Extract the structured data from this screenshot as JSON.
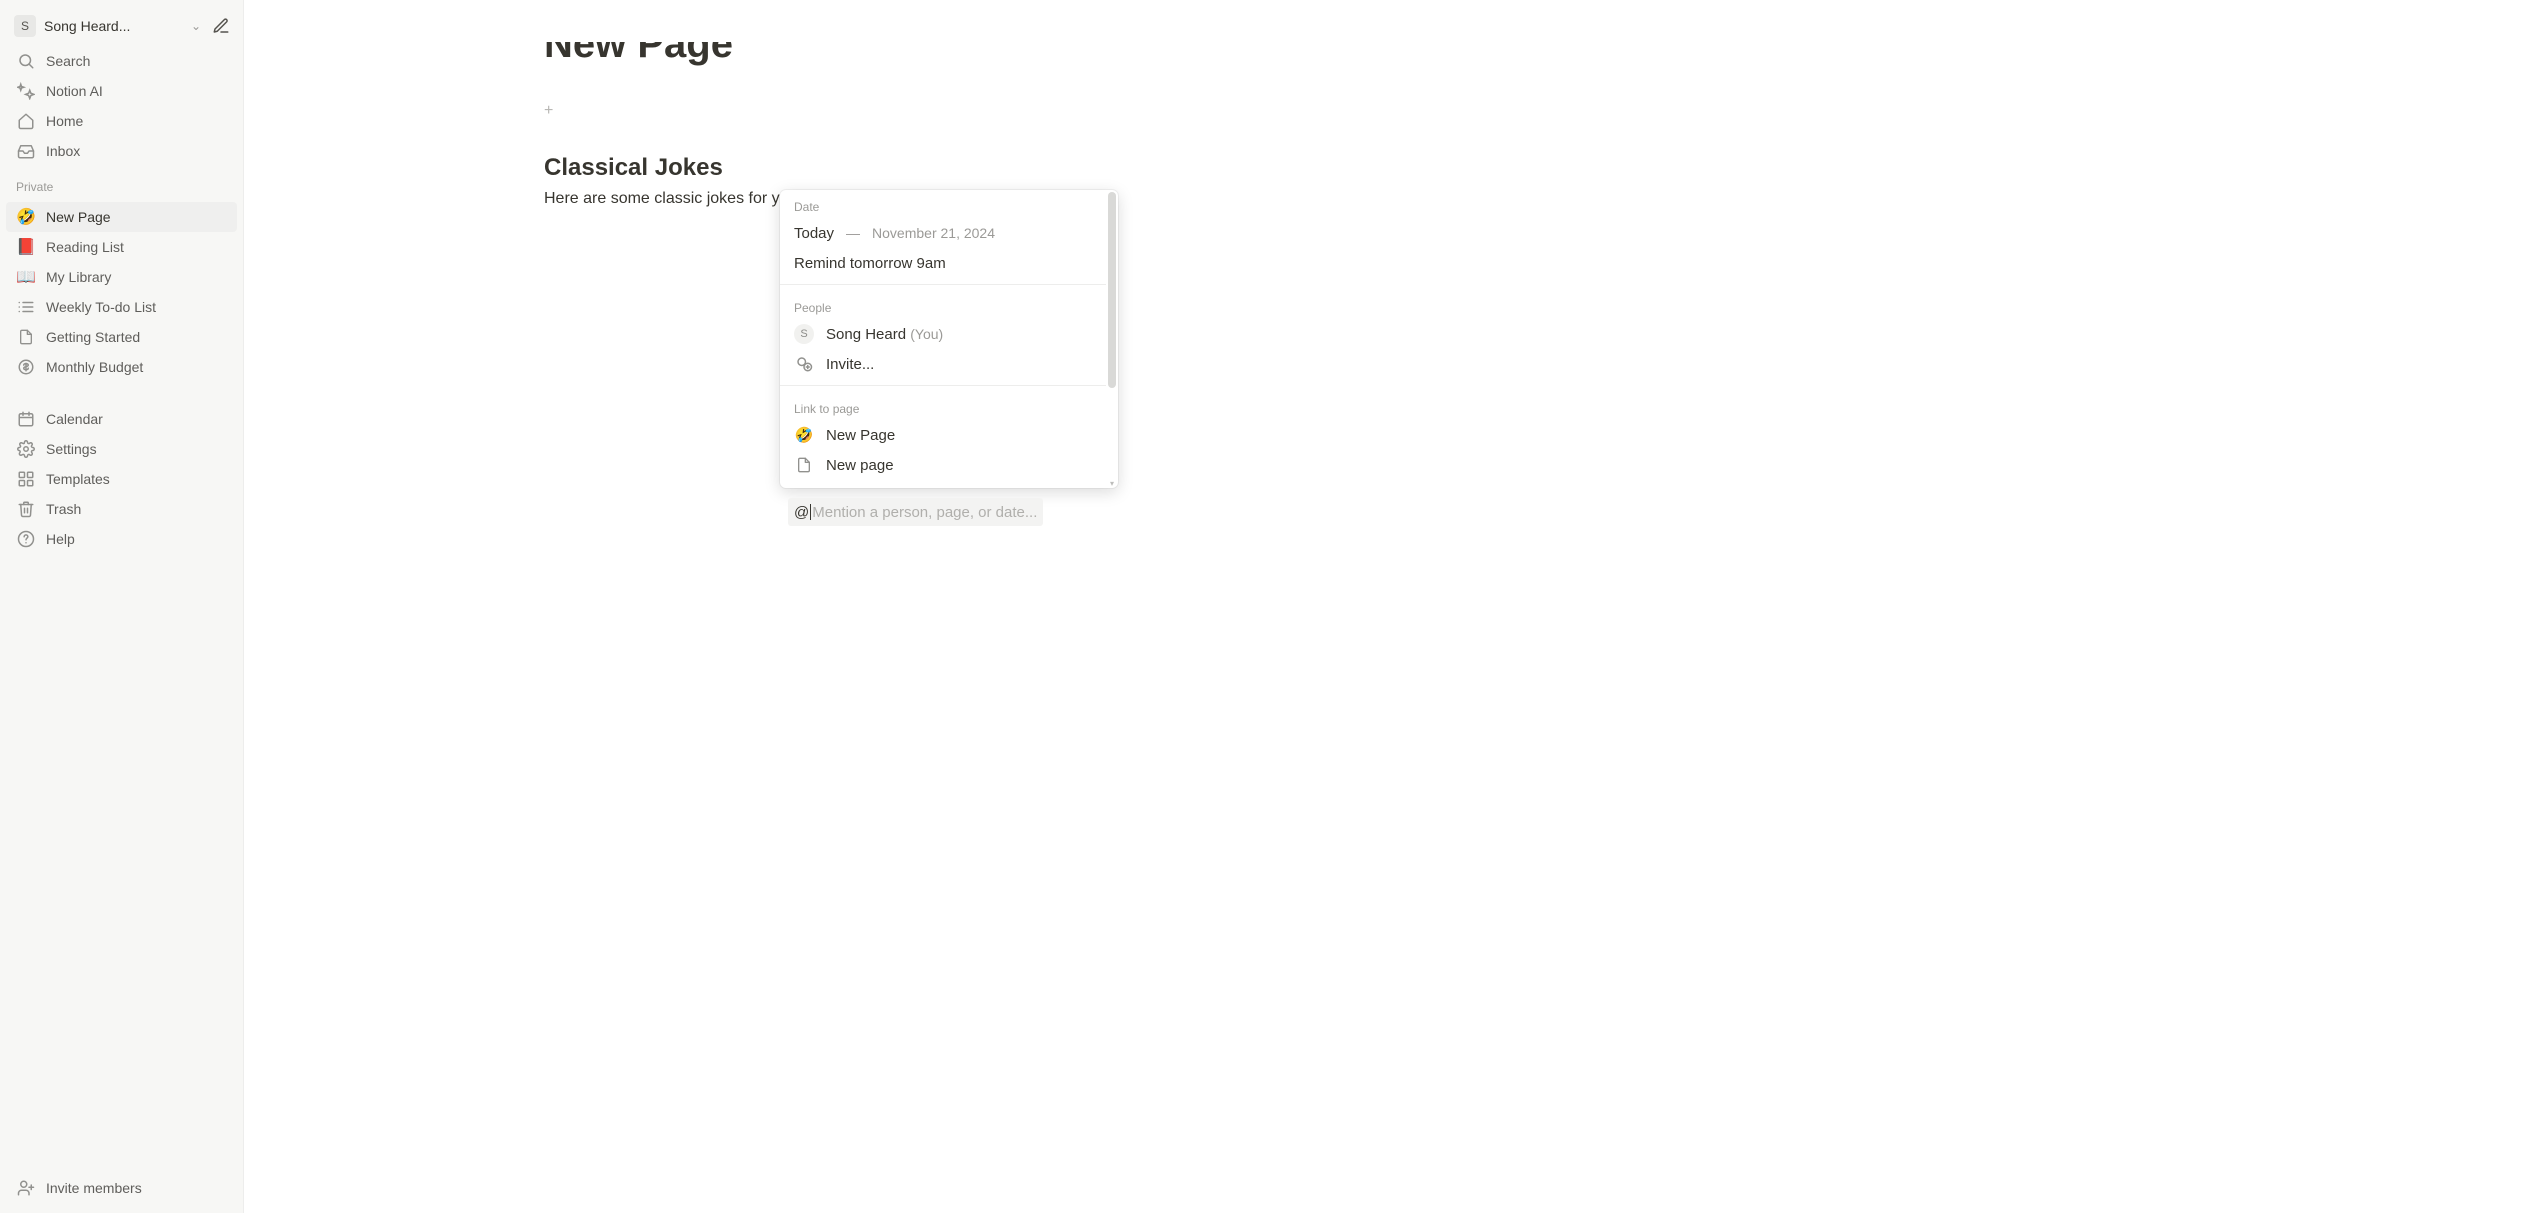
{
  "workspace": {
    "avatar_letter": "S",
    "name": "Song Heard..."
  },
  "sidebar": {
    "top": [
      {
        "icon": "search",
        "label": "Search"
      },
      {
        "icon": "ai",
        "label": "Notion AI"
      },
      {
        "icon": "home",
        "label": "Home"
      },
      {
        "icon": "inbox",
        "label": "Inbox"
      }
    ],
    "private_header": "Private",
    "private": [
      {
        "icon": "🤣",
        "label": "New Page",
        "active": true
      },
      {
        "icon": "📕",
        "label": "Reading List"
      },
      {
        "icon": "📖",
        "label": "My Library"
      },
      {
        "icon": "list",
        "label": "Weekly To-do List"
      },
      {
        "icon": "page",
        "label": "Getting Started"
      },
      {
        "icon": "budget",
        "label": "Monthly Budget"
      }
    ],
    "bottom": [
      {
        "icon": "calendar",
        "label": "Calendar"
      },
      {
        "icon": "settings",
        "label": "Settings"
      },
      {
        "icon": "templates",
        "label": "Templates"
      },
      {
        "icon": "trash",
        "label": "Trash"
      },
      {
        "icon": "help",
        "label": "Help"
      }
    ],
    "footer": {
      "icon": "invite",
      "label": "Invite members"
    }
  },
  "page": {
    "title": "New Page",
    "heading2": "Classical Jokes",
    "body_line": "Here are some classic jokes for your enjoyment:"
  },
  "mention": {
    "prefix": "@",
    "placeholder": "Mention a person, page, or date..."
  },
  "popup": {
    "date_header": "Date",
    "today_label": "Today",
    "today_sep": "—",
    "today_date": "November 21, 2024",
    "remind_label": "Remind tomorrow 9am",
    "people_header": "People",
    "person_avatar": "S",
    "person_name": "Song Heard",
    "person_you": "(You)",
    "invite_label": "Invite...",
    "link_header": "Link to page",
    "link_items": [
      {
        "icon": "🤣",
        "label": "New Page"
      },
      {
        "icon": "page",
        "label": "New page"
      }
    ]
  }
}
